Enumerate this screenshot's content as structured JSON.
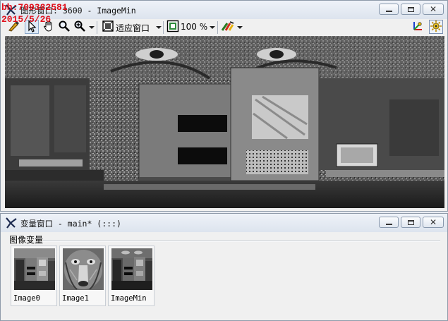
{
  "graphics_window": {
    "title": "图形窗口: 3600 - ImageMin",
    "toolbar": {
      "fit_label": "适应窗口",
      "zoom_value": "100 %"
    }
  },
  "variable_window": {
    "title": "变量窗口 - main* (:::)",
    "section_label": "图像变量",
    "images": [
      {
        "label": "Image0"
      },
      {
        "label": "Image1"
      },
      {
        "label": "ImageMin"
      }
    ]
  },
  "overlay": {
    "line1": "bh:709382581",
    "line2": "2015/5/26"
  },
  "colors": {
    "watermark": "#e0101c",
    "window_bg": "#f0f0f0",
    "titlebar": "#dde4ee"
  }
}
